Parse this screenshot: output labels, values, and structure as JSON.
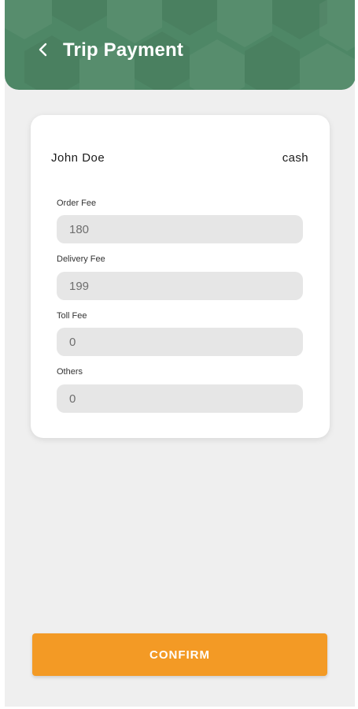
{
  "header": {
    "title": "Trip Payment",
    "back_icon": "chevron-left-icon",
    "background_color": "#4e8766"
  },
  "card": {
    "customer_name": "John Doe",
    "payment_method": "cash",
    "fields": [
      {
        "label": "Order Fee",
        "value": "180"
      },
      {
        "label": "Delivery Fee",
        "value": "199"
      },
      {
        "label": "Toll Fee",
        "value": "0"
      },
      {
        "label": "Others",
        "value": "0"
      }
    ]
  },
  "footer": {
    "confirm_label": "CONFIRM",
    "confirm_color": "#f39a25"
  }
}
